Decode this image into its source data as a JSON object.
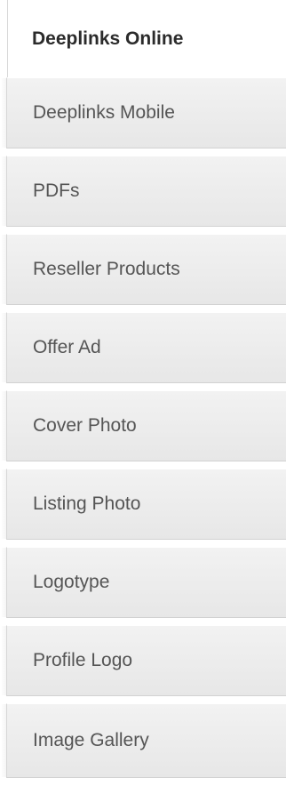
{
  "tabs": [
    {
      "label": "Deeplinks Online",
      "active": true
    },
    {
      "label": "Deeplinks Mobile",
      "active": false
    },
    {
      "label": "PDFs",
      "active": false
    },
    {
      "label": "Reseller Products",
      "active": false
    },
    {
      "label": "Offer Ad",
      "active": false
    },
    {
      "label": "Cover Photo",
      "active": false
    },
    {
      "label": "Listing Photo",
      "active": false
    },
    {
      "label": "Logotype",
      "active": false
    },
    {
      "label": "Profile Logo",
      "active": false
    },
    {
      "label": "Image Gallery",
      "active": false
    }
  ]
}
